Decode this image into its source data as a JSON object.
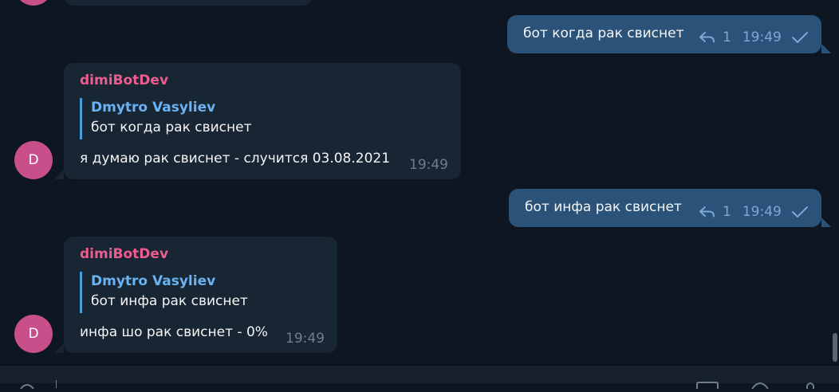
{
  "messages": [
    {
      "direction": "outgoing",
      "text": "бот когда рак свиснет",
      "reply_count": "1",
      "time": "19:49",
      "status_icon": "single-check-icon"
    },
    {
      "direction": "incoming",
      "avatar_letter": "D",
      "sender": "dimiBotDev",
      "reply_to": {
        "author": "Dmytro Vasyliev",
        "text": "бот когда рак свиснет"
      },
      "text": "я думаю рак свиснет - случится 03.08.2021",
      "time": "19:49"
    },
    {
      "direction": "outgoing",
      "text": "бот инфа рак свиснет",
      "reply_count": "1",
      "time": "19:49",
      "status_icon": "single-check-icon"
    },
    {
      "direction": "incoming",
      "avatar_letter": "D",
      "sender": "dimiBotDev",
      "reply_to": {
        "author": "Dmytro Vasyliev",
        "text": "бот инфа рак свиснет"
      },
      "text": "инфа шо рак свиснет - 0%",
      "time": "19:49"
    }
  ],
  "colors": {
    "background": "#0e1621",
    "incoming_bubble": "#182533",
    "outgoing_bubble": "#2b5278",
    "sender_name": "#ee5d90",
    "reply_author": "#6ab3f3",
    "avatar": "#c94f8a"
  }
}
